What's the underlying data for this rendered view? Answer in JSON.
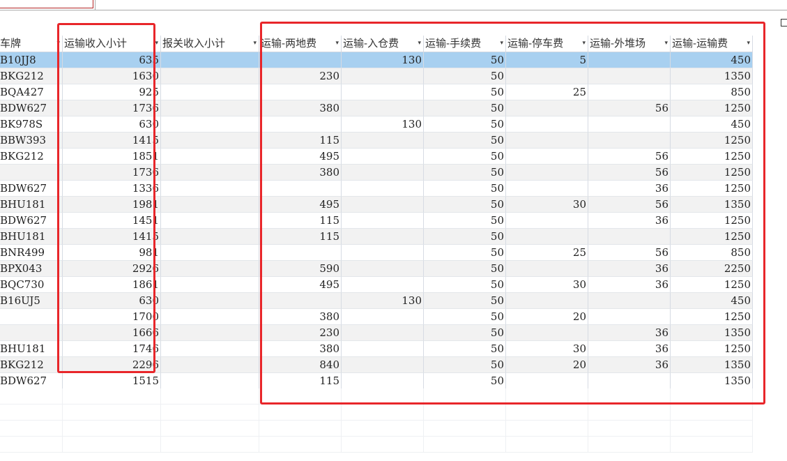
{
  "table": {
    "columns": [
      {
        "label": "车牌",
        "align": "left"
      },
      {
        "label": "运输收入小计",
        "align": "right"
      },
      {
        "label": "报关收入小计",
        "align": "right"
      },
      {
        "label": "运输-两地费",
        "align": "right"
      },
      {
        "label": "运输-入仓费",
        "align": "right"
      },
      {
        "label": "运输-手续费",
        "align": "right"
      },
      {
        "label": "运输-停车费",
        "align": "right"
      },
      {
        "label": "运输-外堆场",
        "align": "right"
      },
      {
        "label": "运输-运输费",
        "align": "right"
      }
    ],
    "rows": [
      [
        "B10JJ8",
        "635",
        "",
        "",
        "130",
        "50",
        "5",
        "",
        "450"
      ],
      [
        "BKG212",
        "1630",
        "",
        "230",
        "",
        "50",
        "",
        "",
        "1350"
      ],
      [
        "BQA427",
        "925",
        "",
        "",
        "",
        "50",
        "25",
        "",
        "850"
      ],
      [
        "BDW627",
        "1736",
        "",
        "380",
        "",
        "50",
        "",
        "56",
        "1250"
      ],
      [
        "BK978S",
        "630",
        "",
        "",
        "130",
        "50",
        "",
        "",
        "450"
      ],
      [
        "BBW393",
        "1415",
        "",
        "115",
        "",
        "50",
        "",
        "",
        "1250"
      ],
      [
        "BKG212",
        "1851",
        "",
        "495",
        "",
        "50",
        "",
        "56",
        "1250"
      ],
      [
        "",
        "1736",
        "",
        "380",
        "",
        "50",
        "",
        "56",
        "1250"
      ],
      [
        "BDW627",
        "1336",
        "",
        "",
        "",
        "50",
        "",
        "36",
        "1250"
      ],
      [
        "BHU181",
        "1981",
        "",
        "495",
        "",
        "50",
        "30",
        "56",
        "1350"
      ],
      [
        "BDW627",
        "1451",
        "",
        "115",
        "",
        "50",
        "",
        "36",
        "1250"
      ],
      [
        "BHU181",
        "1415",
        "",
        "115",
        "",
        "50",
        "",
        "",
        "1250"
      ],
      [
        "BNR499",
        "981",
        "",
        "",
        "",
        "50",
        "25",
        "56",
        "850"
      ],
      [
        "BPX043",
        "2926",
        "",
        "590",
        "",
        "50",
        "",
        "36",
        "2250"
      ],
      [
        "BQC730",
        "1861",
        "",
        "495",
        "",
        "50",
        "30",
        "36",
        "1250"
      ],
      [
        "B16UJ5",
        "630",
        "",
        "",
        "130",
        "50",
        "",
        "",
        "450"
      ],
      [
        "",
        "1700",
        "",
        "380",
        "",
        "50",
        "20",
        "",
        "1250"
      ],
      [
        "",
        "1666",
        "",
        "230",
        "",
        "50",
        "",
        "36",
        "1350"
      ],
      [
        "BHU181",
        "1746",
        "",
        "380",
        "",
        "50",
        "30",
        "36",
        "1250"
      ],
      [
        "BKG212",
        "2296",
        "",
        "840",
        "",
        "50",
        "20",
        "36",
        "1350"
      ],
      [
        "BDW627",
        "1515",
        "",
        "115",
        "",
        "50",
        "",
        "",
        "1350"
      ]
    ],
    "selected_row": 0,
    "filter_arrow": "▾",
    "colors": {
      "selected": "#a8d0f0",
      "alt_row": "#f2f2f2",
      "highlight_box": "#e8262a"
    }
  }
}
